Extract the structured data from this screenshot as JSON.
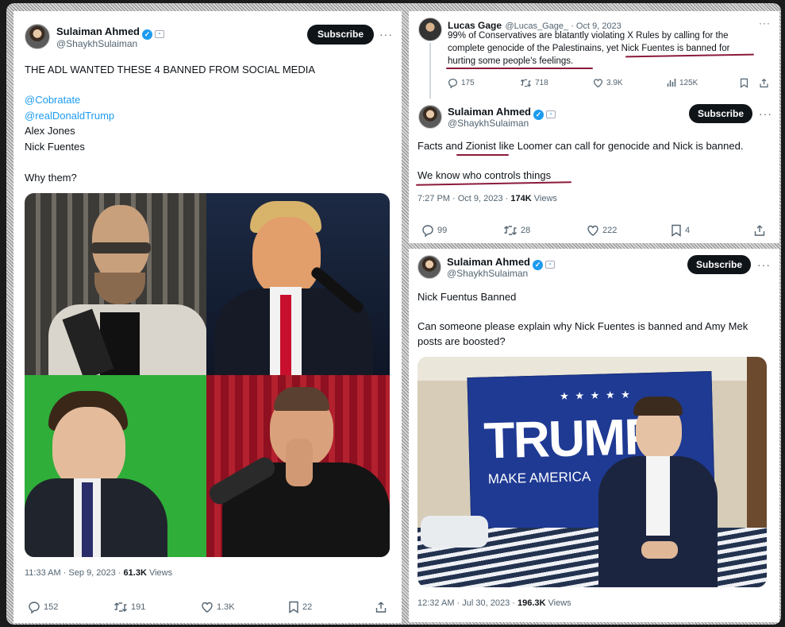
{
  "left_tweet": {
    "author_name": "Sulaiman Ahmed",
    "handle": "@ShaykhSulaiman",
    "subscribe_label": "Subscribe",
    "more": "···",
    "line1": "THE ADL WANTED THESE 4 BANNED FROM SOCIAL MEDIA",
    "mention1": "@Cobratate",
    "mention2": "@realDonaldTrump",
    "line_alex": "Alex Jones",
    "line_nick": "Nick Fuentes",
    "question": "Why them?",
    "timestamp": "11:33 AM · Sep 9, 2023 · ",
    "views": "61.3K",
    "views_label": " Views",
    "replies": "152",
    "reposts": "191",
    "likes": "1.3K",
    "bookmarks": "22"
  },
  "top_right": {
    "quoted": {
      "author_name": "Lucas Gage",
      "handle_date": "@Lucas_Gage_ · Oct 9, 2023",
      "more": "···",
      "text1": "99% of Conservatives are blatantly violating X Rules by calling for the",
      "text2_a": "complete genocide of the Palestinains, yet ",
      "text2_b": "Nick Fuentes is banned for",
      "text3": "hurting some people's feelings.",
      "replies": "175",
      "reposts": "718",
      "likes": "3.9K",
      "views": "125K"
    },
    "reply": {
      "author_name": "Sulaiman Ahmed",
      "handle": "@ShaykhSulaiman",
      "subscribe_label": "Subscribe",
      "more": "···",
      "text1": "Facts and Zionist like Loomer can call for genocide and Nick is banned.",
      "text2": "We know who controls things",
      "timestamp": "7:27 PM · Oct 9, 2023 · ",
      "views": "174K",
      "views_label": " Views",
      "replies": "99",
      "reposts": "28",
      "likes": "222",
      "bookmarks": "4"
    }
  },
  "bottom_right": {
    "author_name": "Sulaiman Ahmed",
    "handle": "@ShaykhSulaiman",
    "subscribe_label": "Subscribe",
    "more": "···",
    "text1": "Nick Fuentus Banned",
    "text2": "Can someone please explain why Nick Fuentes is banned and Amy Mek",
    "text3": "posts are boosted?",
    "flag_word": "TRUMP",
    "flag_sub": "MAKE AMERICA",
    "flag_stars": "★ ★ ★ ★ ★",
    "flag_stars2": "★ ★ ★",
    "timestamp": "12:32 AM · Jul 30, 2023 · ",
    "views": "196.3K",
    "views_label": " Views"
  },
  "colors": {
    "link": "#1d9bf0",
    "underline": "#8b1a3a",
    "button": "#0f1419"
  }
}
